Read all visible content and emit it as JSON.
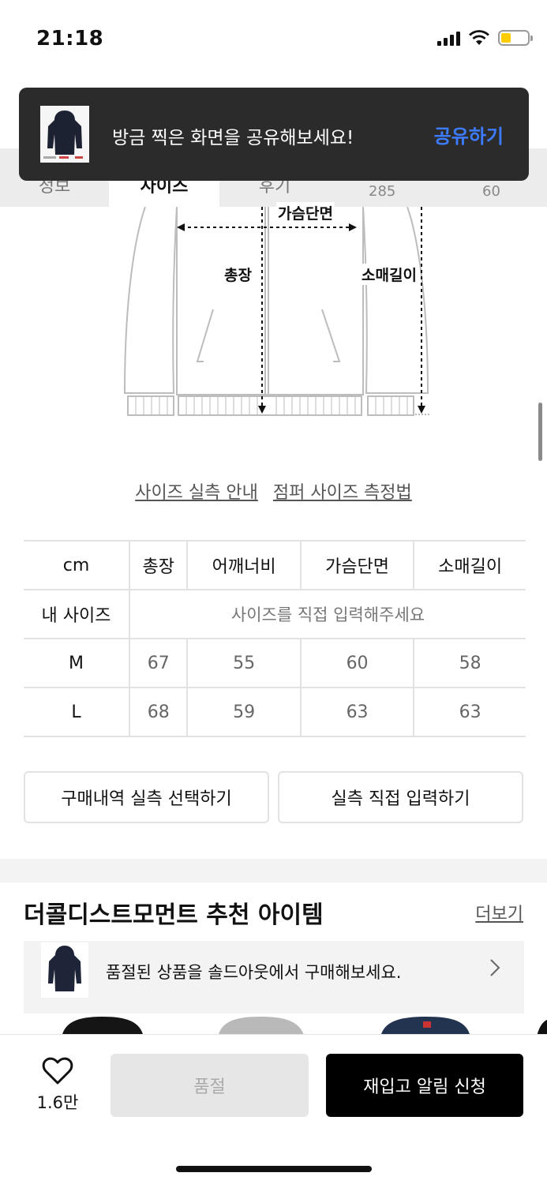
{
  "status_bar": {
    "time": "21:18",
    "battery_color": "#ffcc00"
  },
  "toast": {
    "message": "방금 찍은 화면을 공유해보세요!",
    "action": "공유하기",
    "action_color": "#3d7bff"
  },
  "tabs": {
    "items": [
      "정보",
      "사이즈",
      "후기"
    ],
    "stats": [
      "285",
      "60"
    ]
  },
  "diagram": {
    "labels": {
      "chest": "가슴단면",
      "length": "총장",
      "sleeve": "소매길이"
    }
  },
  "size_links": {
    "guide": "사이즈 실측 안내",
    "method": "점퍼 사이즈 측정법"
  },
  "size_table": {
    "headers": [
      "cm",
      "총장",
      "어깨너비",
      "가슴단면",
      "소매길이"
    ],
    "my_size_label": "내 사이즈",
    "my_size_placeholder": "사이즈를 직접 입력해주세요",
    "rows": [
      {
        "size": "M",
        "values": [
          "67",
          "55",
          "60",
          "58"
        ]
      },
      {
        "size": "L",
        "values": [
          "68",
          "59",
          "63",
          "63"
        ]
      }
    ]
  },
  "actions": {
    "purchase_history": "구매내역 실측 선택하기",
    "manual_input": "실측 직접 입력하기"
  },
  "recommend": {
    "title": "더콜디스트모먼트 추천 아이템",
    "more": "더보기",
    "soldout_banner": "품절된 상품을 솔드아웃에서 구매해보세요."
  },
  "bottom_bar": {
    "like_count": "1.6만",
    "soldout_label": "품절",
    "restock_label": "재입고 알림 신청"
  }
}
